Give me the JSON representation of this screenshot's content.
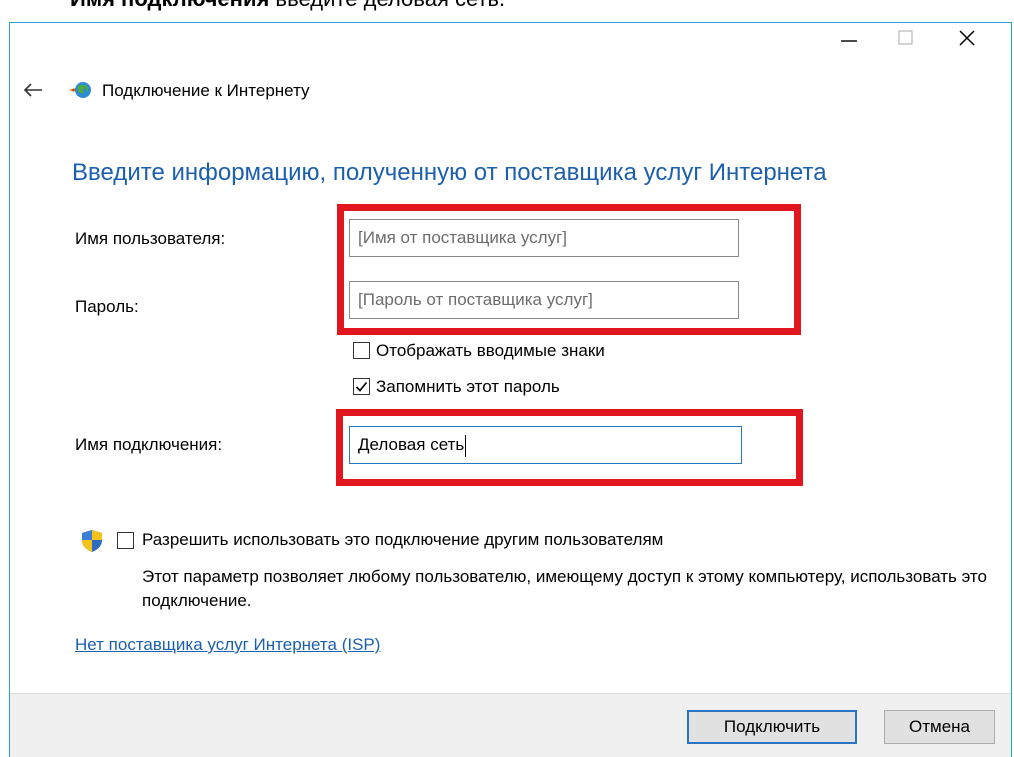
{
  "top_text": {
    "bold": "Имя подключения",
    "rest": " введите деловая сеть."
  },
  "window": {
    "nav_title": "Подключение к Интернету",
    "heading": "Введите информацию, полученную от поставщика услуг Интернета"
  },
  "form": {
    "username": {
      "label": "Имя пользователя:",
      "value": "",
      "placeholder": "[Имя от поставщика услуг]"
    },
    "password": {
      "label": "Пароль:",
      "value": "",
      "placeholder": "[Пароль от поставщика услуг]"
    },
    "show_chars": {
      "label": "Отображать вводимые знаки",
      "checked": false
    },
    "remember": {
      "label": "Запомнить этот пароль",
      "checked": true
    },
    "connection_name": {
      "label": "Имя подключения:",
      "value": "Деловая сеть"
    },
    "allow_others": {
      "label": "Разрешить использовать это подключение другим пользователям",
      "checked": false,
      "description": "Этот параметр позволяет любому пользователю, имеющему доступ к этому компьютеру, использовать это подключение."
    }
  },
  "link": {
    "no_isp": "Нет поставщика услуг Интернета (ISP)"
  },
  "buttons": {
    "connect": "Подключить",
    "cancel": "Отмена"
  },
  "colors": {
    "accent": "#1c5fae",
    "highlight_frame": "#e2161f",
    "window_border": "#2a9fd6"
  },
  "icons": {
    "back": "back-arrow-icon",
    "app": "internet-connection-icon",
    "shield": "uac-shield-icon",
    "minimize": "minimize-icon",
    "maximize": "maximize-icon",
    "close": "close-icon"
  }
}
